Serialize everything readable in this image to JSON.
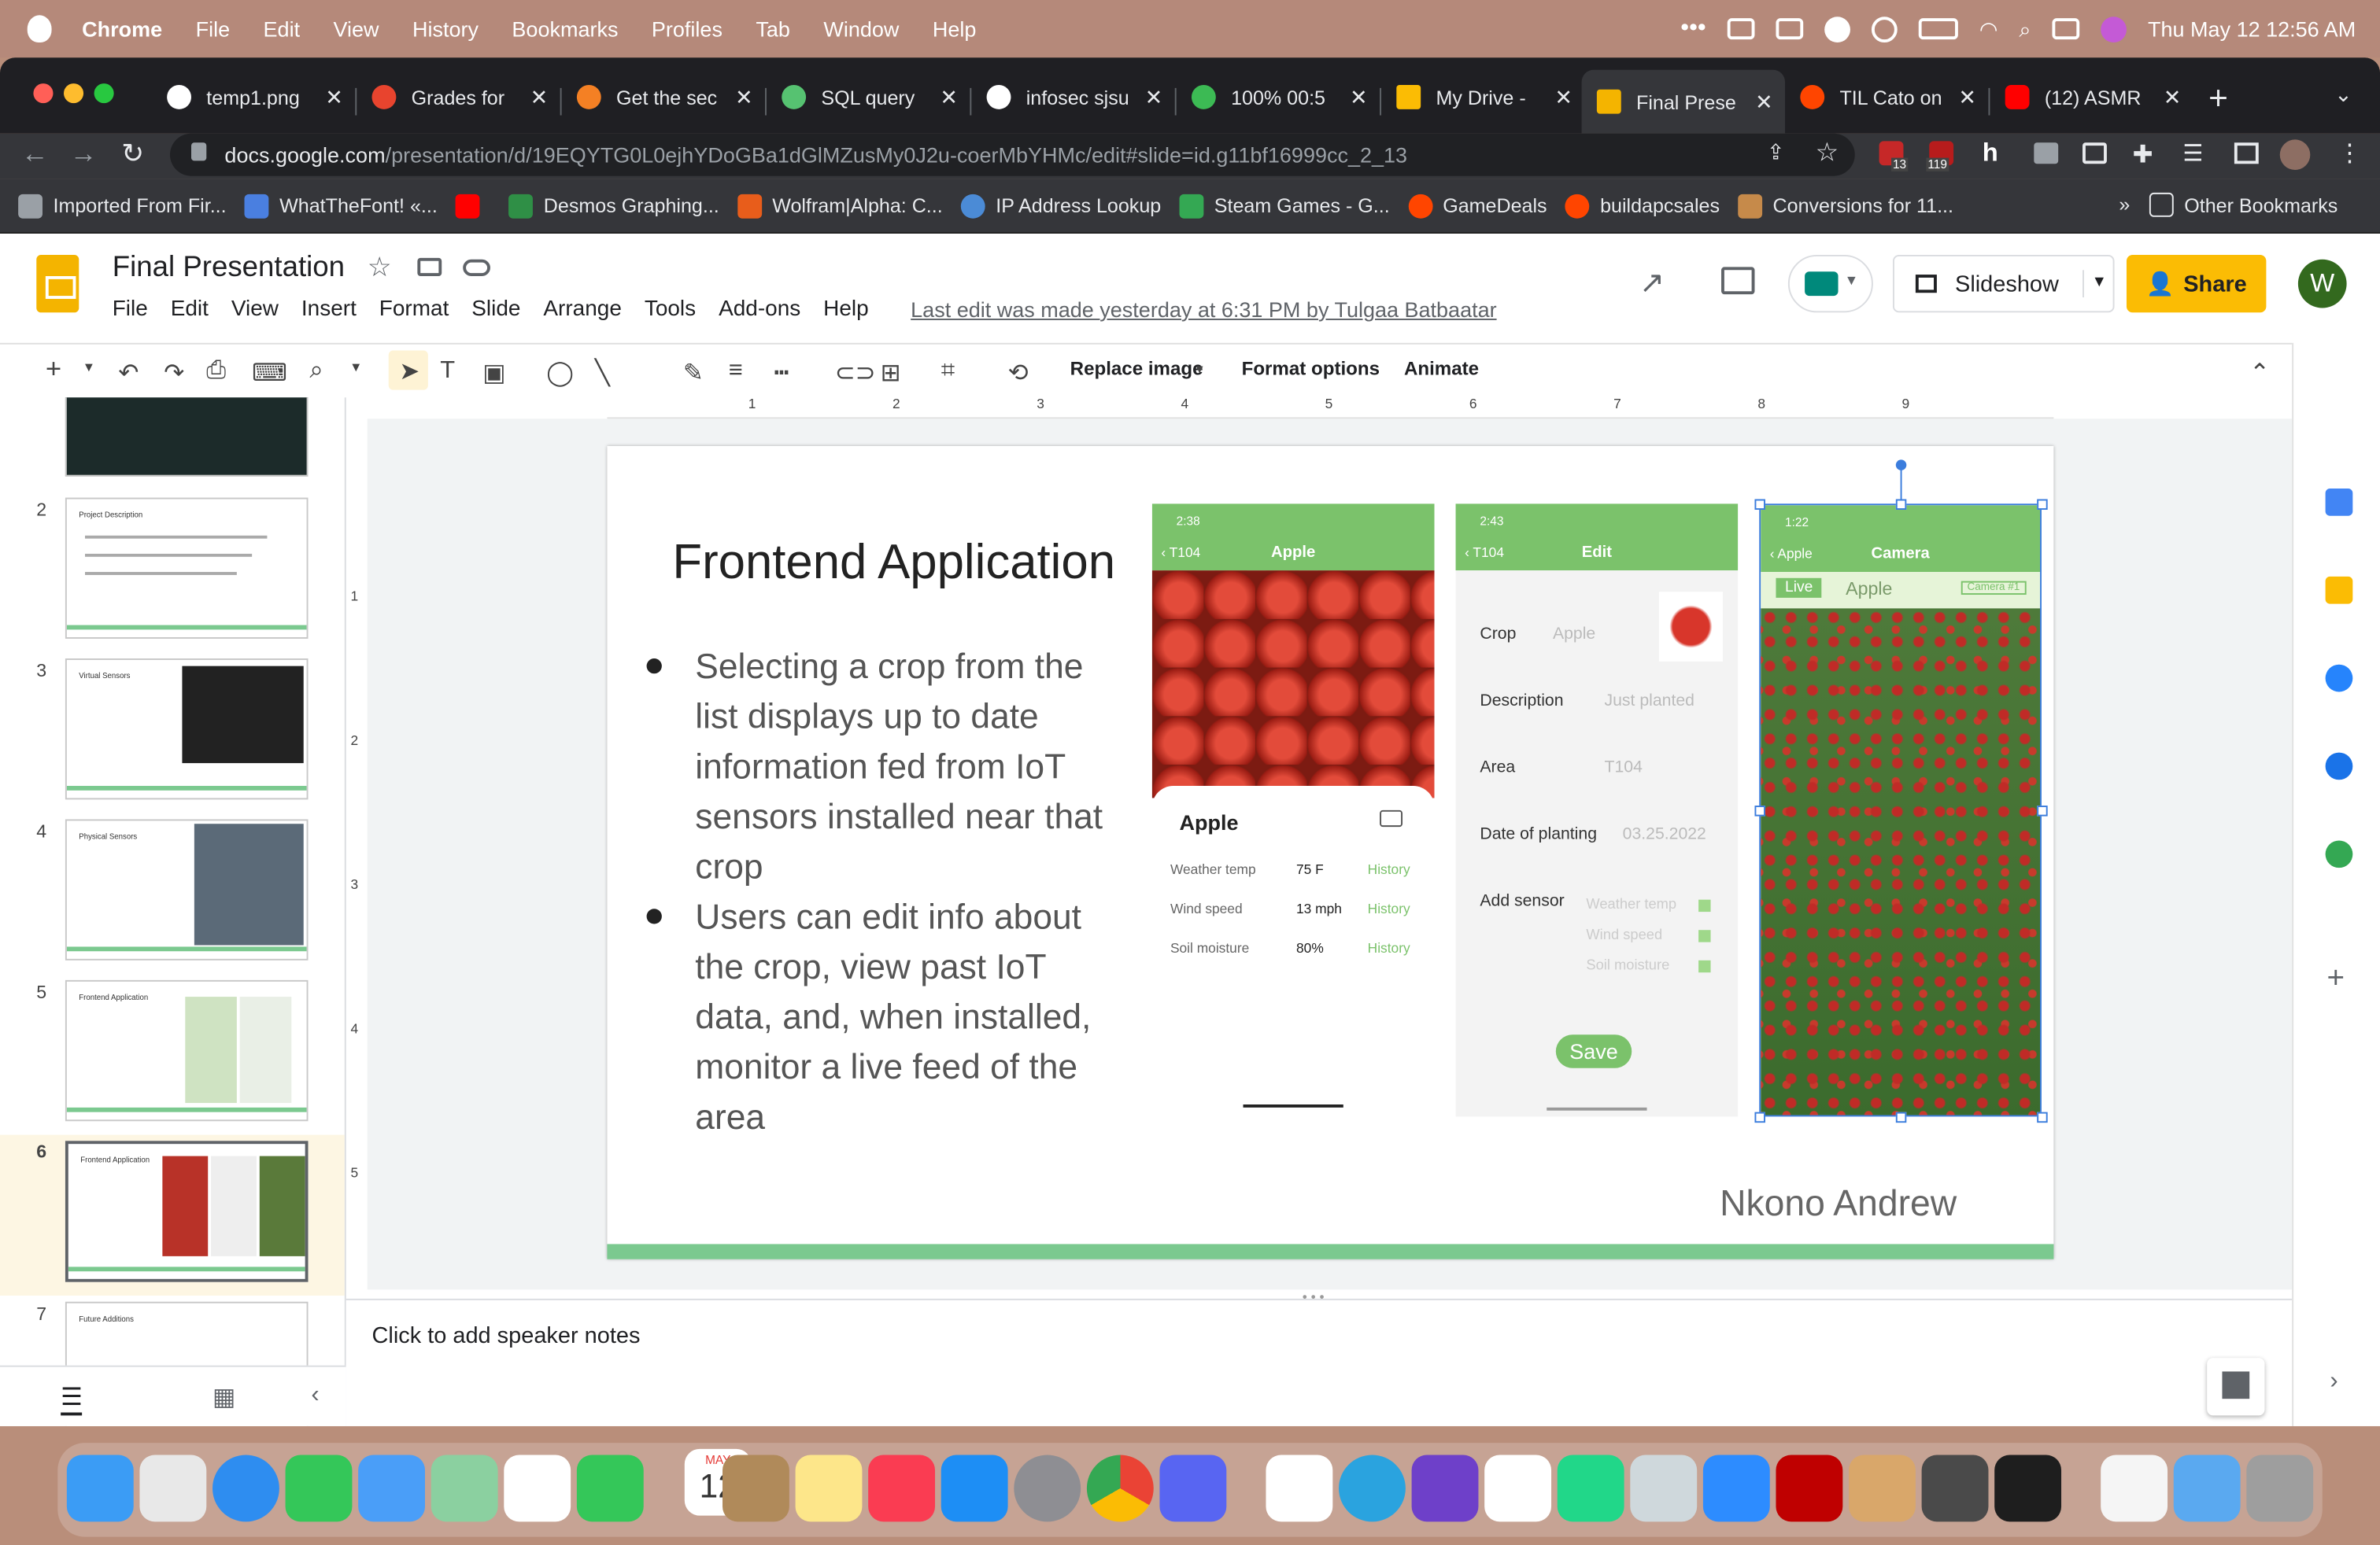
{
  "menubar": {
    "app": "Chrome",
    "items": [
      "File",
      "Edit",
      "View",
      "History",
      "Bookmarks",
      "Profiles",
      "Tab",
      "Window",
      "Help"
    ],
    "clock": "Thu May 12  12:56 AM"
  },
  "tabs": [
    {
      "label": "temp1.png",
      "color": "#ffffff"
    },
    {
      "label": "Grades for",
      "color": "#e8442e"
    },
    {
      "label": "Get the sec",
      "color": "#f48024"
    },
    {
      "label": "SQL query",
      "color": "#56c271"
    },
    {
      "label": "infosec sjsu",
      "color": "#ffffff"
    },
    {
      "label": "100% 00:5",
      "color": "#3cba54"
    },
    {
      "label": "My Drive -",
      "color": "#fbbc04"
    },
    {
      "label": "Final Prese",
      "color": "#f4b400"
    },
    {
      "label": "TIL Cato on",
      "color": "#ff4500"
    },
    {
      "label": "(12) ASMR",
      "color": "#ff0000"
    }
  ],
  "address": {
    "host": "docs.google.com",
    "path": "/presentation/d/19EQYTG0L0ejhYDoGBa1dGlMZusMy0J2u-coerMbYHMc/edit#slide=id.g11bf16999cc_2_13"
  },
  "extensions": {
    "badge1": "13",
    "badge2": "119"
  },
  "bookmarks": [
    {
      "label": "Imported From Fir...",
      "color": "#9aa0a6"
    },
    {
      "label": "WhatTheFont! «...",
      "color": "#4a7fe0"
    },
    {
      "label": "",
      "color": "#ff0000"
    },
    {
      "label": "Desmos Graphing...",
      "color": "#2f8f46"
    },
    {
      "label": "Wolfram|Alpha: C...",
      "color": "#e85d1b"
    },
    {
      "label": "IP Address Lookup",
      "color": "#4b8bd6"
    },
    {
      "label": "Steam Games - G...",
      "color": "#34a853"
    },
    {
      "label": "GameDeals",
      "color": "#ff4500"
    },
    {
      "label": "buildapcsales",
      "color": "#ff4500"
    },
    {
      "label": "Conversions for 11...",
      "color": "#c68a4a"
    }
  ],
  "bookmarks_more": "»",
  "other_bookmarks": "Other Bookmarks",
  "doc": {
    "title": "Final Presentation",
    "menus": [
      "File",
      "Edit",
      "View",
      "Insert",
      "Format",
      "Slide",
      "Arrange",
      "Tools",
      "Add-ons",
      "Help"
    ],
    "last_edit": "Last edit was made yesterday at 6:31 PM by Tulgaa Batbaatar",
    "slideshow": "Slideshow",
    "share": "Share",
    "avatar": "W"
  },
  "toolbar": {
    "replace_image": "Replace image",
    "format_options": "Format options",
    "animate": "Animate"
  },
  "ruler": [
    "1",
    "2",
    "3",
    "4",
    "5",
    "6",
    "7",
    "8",
    "9"
  ],
  "vruler": [
    "1",
    "2",
    "3",
    "4",
    "5"
  ],
  "thumbnails": [
    {
      "num": "",
      "title": ""
    },
    {
      "num": "2",
      "title": "Project Description"
    },
    {
      "num": "3",
      "title": "Virtual Sensors"
    },
    {
      "num": "4",
      "title": "Physical Sensors"
    },
    {
      "num": "5",
      "title": "Frontend Application"
    },
    {
      "num": "6",
      "title": "Frontend Application"
    },
    {
      "num": "7",
      "title": "Future Additions"
    }
  ],
  "slide": {
    "title": "Frontend Application",
    "bullets": [
      "Selecting a crop from the list displays up to date information fed from IoT sensors installed near that crop",
      "Users can edit info about the crop, view past IoT data, and, when installed, monitor a live feed of the area"
    ],
    "author": "Nkono Andrew",
    "phone1": {
      "time": "2:38",
      "back": "T104",
      "title": "Apple",
      "name": "Apple",
      "rows": [
        {
          "label": "Weather temp",
          "value": "75 F",
          "link": "History"
        },
        {
          "label": "Wind speed",
          "value": "13 mph",
          "link": "History"
        },
        {
          "label": "Soil moisture",
          "value": "80%",
          "link": "History"
        }
      ]
    },
    "phone2": {
      "time": "2:43",
      "back": "T104",
      "title": "Edit",
      "crop_label": "Crop",
      "crop_value": "Apple",
      "desc_label": "Description",
      "desc_value": "Just planted",
      "area_label": "Area",
      "area_value": "T104",
      "date_label": "Date of planting",
      "date_value": "03.25.2022",
      "sensor_label": "Add sensor",
      "sensors": [
        "Weather temp",
        "Wind speed",
        "Soil moisture"
      ],
      "save": "Save"
    },
    "phone3": {
      "time": "1:22",
      "back": "Apple",
      "title": "Camera",
      "live": "Live",
      "crop": "Apple",
      "camera": "Camera #1"
    }
  },
  "notes": "Click to add speaker notes",
  "dock": {
    "calendar_month": "MAY",
    "calendar_day": "12"
  }
}
